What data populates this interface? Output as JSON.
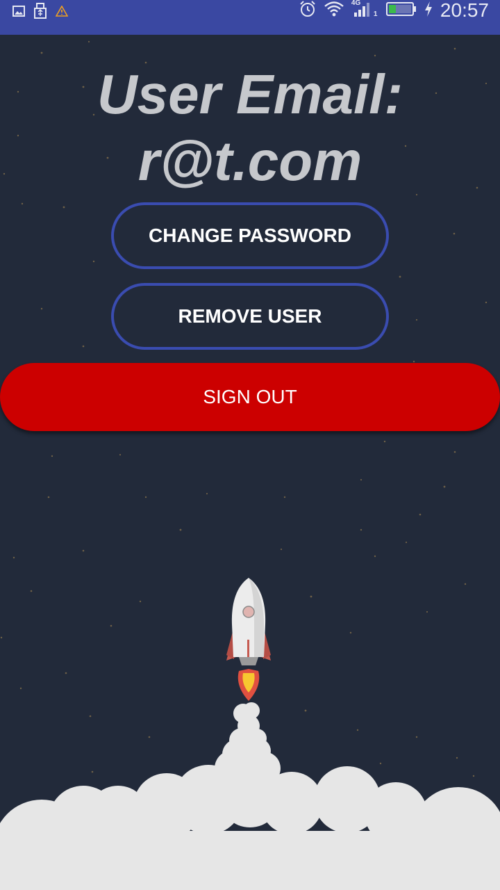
{
  "status_bar": {
    "time": "20:57",
    "network_type": "4G",
    "sim_slot": "1",
    "icons": [
      "image-icon",
      "usb-icon",
      "warning-icon",
      "alarm-icon",
      "wifi-icon",
      "signal-icon",
      "battery-icon",
      "charging-icon"
    ]
  },
  "profile": {
    "email_label": "User Email:",
    "email_value": "r@t.com"
  },
  "actions": {
    "change_password_label": "CHANGE PASSWORD",
    "remove_user_label": "REMOVE USER",
    "sign_out_label": "SIGN OUT"
  },
  "colors": {
    "status_bar": "#3a48a2",
    "background": "#222a3a",
    "button_outline": "#3a4cb0",
    "sign_out": "#cc0000",
    "smoke": "#e6e6e6"
  }
}
